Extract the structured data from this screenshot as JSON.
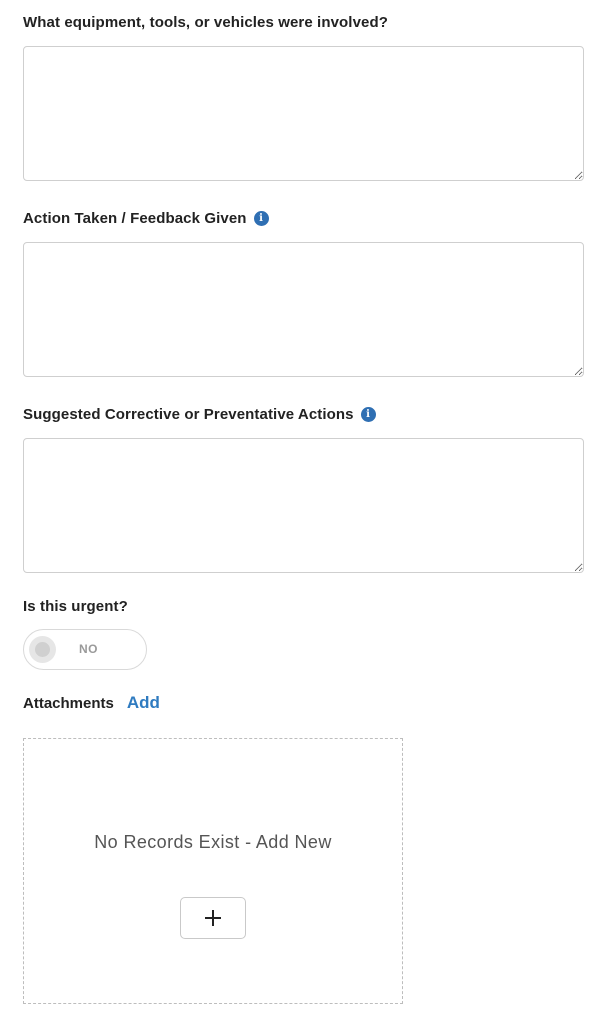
{
  "fields": [
    {
      "label": "What equipment, tools, or vehicles were involved?",
      "value": "",
      "has_info": false
    },
    {
      "label": "Action Taken / Feedback Given",
      "value": "",
      "has_info": true
    },
    {
      "label": "Suggested Corrective or Preventative Actions",
      "value": "",
      "has_info": true
    }
  ],
  "urgent": {
    "label": "Is this urgent?",
    "toggle_text": "NO",
    "value": false
  },
  "attachments": {
    "label": "Attachments",
    "add_label": "Add",
    "empty_text": "No Records Exist - Add New",
    "add_icon": "plus-icon"
  },
  "info_icon": {
    "glyph": "i",
    "name": "info-icon"
  },
  "colors": {
    "accent": "#2f7bc0",
    "info_icon": "#2f6fb3",
    "label_text": "#222222",
    "border": "#cfcfcf"
  }
}
